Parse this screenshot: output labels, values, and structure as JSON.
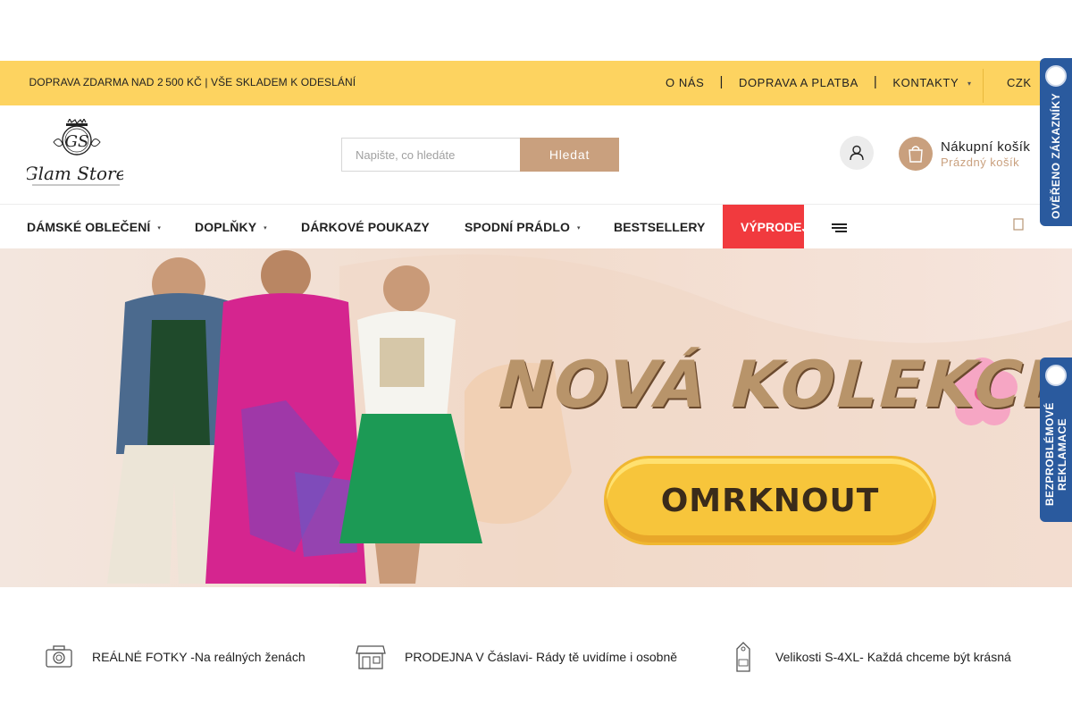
{
  "topbar": {
    "promo": " DOPRAVA ZDARMA NAD 2 500 KČ | VŠE SKLADEM K ODESLÁNÍ  ",
    "links": [
      "O NÁS",
      "DOPRAVA A PLATBA",
      "KONTAKTY"
    ],
    "currency": "CZK"
  },
  "header": {
    "logo_text": "Glam Store",
    "logo_monogram": "GS",
    "search_placeholder": "Napište, co hledáte",
    "search_button": "Hledat",
    "cart_title": "Nákupní košík",
    "cart_status": "Prázdný košík"
  },
  "nav": {
    "items": [
      {
        "label": "DÁMSKÉ OBLEČENÍ",
        "has_submenu": true
      },
      {
        "label": "DOPLŇKY",
        "has_submenu": true
      },
      {
        "label": "DÁRKOVÉ POUKAZY",
        "has_submenu": false
      },
      {
        "label": "SPODNÍ PRÁDLO",
        "has_submenu": true
      },
      {
        "label": "BESTSELLERY",
        "has_submenu": false
      }
    ],
    "sale_label": "VÝPRODEJ",
    "sale_color": "#f13a3e"
  },
  "hero": {
    "headline": "NOVÁ KOLEKCE",
    "cta": "OMRKNOUT"
  },
  "badges": {
    "verified": "OVĚŘENO ZÁKAZNÍKY",
    "returns": "BEZPROBLÉMOVÉ REKLAMACE"
  },
  "features": [
    {
      "icon": "camera-icon",
      "text": "REÁLNÉ FOTKY -Na reálných ženách"
    },
    {
      "icon": "store-icon",
      "text": "PRODEJNA V Čáslavi- Rády tě uvidíme i osobně"
    },
    {
      "icon": "size-tag-icon",
      "text": "Velikosti S-4XL- Každá chceme být krásná"
    }
  ],
  "colors": {
    "topbar": "#fdd360",
    "accent": "#c9a07e",
    "badge": "#2a5a9e"
  }
}
